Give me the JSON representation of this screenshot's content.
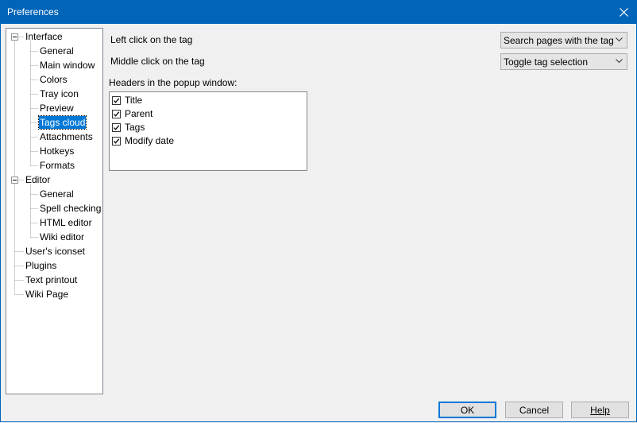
{
  "window": {
    "title": "Preferences"
  },
  "tree": {
    "items": [
      {
        "label": "Interface",
        "level": 0,
        "expander": "minus",
        "row": 0
      },
      {
        "label": "General",
        "level": 1,
        "row": 1
      },
      {
        "label": "Main window",
        "level": 1,
        "row": 2
      },
      {
        "label": "Colors",
        "level": 1,
        "row": 3
      },
      {
        "label": "Tray icon",
        "level": 1,
        "row": 4
      },
      {
        "label": "Preview",
        "level": 1,
        "row": 5
      },
      {
        "label": "Tags cloud",
        "level": 1,
        "row": 6,
        "selected": true
      },
      {
        "label": "Attachments",
        "level": 1,
        "row": 7
      },
      {
        "label": "Hotkeys",
        "level": 1,
        "row": 8
      },
      {
        "label": "Formats",
        "level": 1,
        "row": 9
      },
      {
        "label": "Editor",
        "level": 0,
        "expander": "minus",
        "row": 10
      },
      {
        "label": "General",
        "level": 1,
        "row": 11
      },
      {
        "label": "Spell checking",
        "level": 1,
        "row": 12
      },
      {
        "label": "HTML editor",
        "level": 1,
        "row": 13
      },
      {
        "label": "Wiki editor",
        "level": 1,
        "row": 14
      },
      {
        "label": "User's iconset",
        "level": 0,
        "row": 15
      },
      {
        "label": "Plugins",
        "level": 0,
        "row": 16
      },
      {
        "label": "Text printout",
        "level": 0,
        "row": 17
      },
      {
        "label": "Wiki Page",
        "level": 0,
        "row": 18
      }
    ]
  },
  "settings": {
    "left_click_label": "Left click on the tag",
    "left_click_value": "Search pages with the tag",
    "middle_click_label": "Middle click on the tag",
    "middle_click_value": "Toggle tag selection",
    "headers_label": "Headers in the popup window:",
    "headers": [
      {
        "label": "Title",
        "checked": true
      },
      {
        "label": "Parent",
        "checked": true
      },
      {
        "label": "Tags",
        "checked": true
      },
      {
        "label": "Modify date",
        "checked": true
      }
    ]
  },
  "buttons": {
    "ok": "OK",
    "cancel": "Cancel",
    "help": "Help"
  }
}
